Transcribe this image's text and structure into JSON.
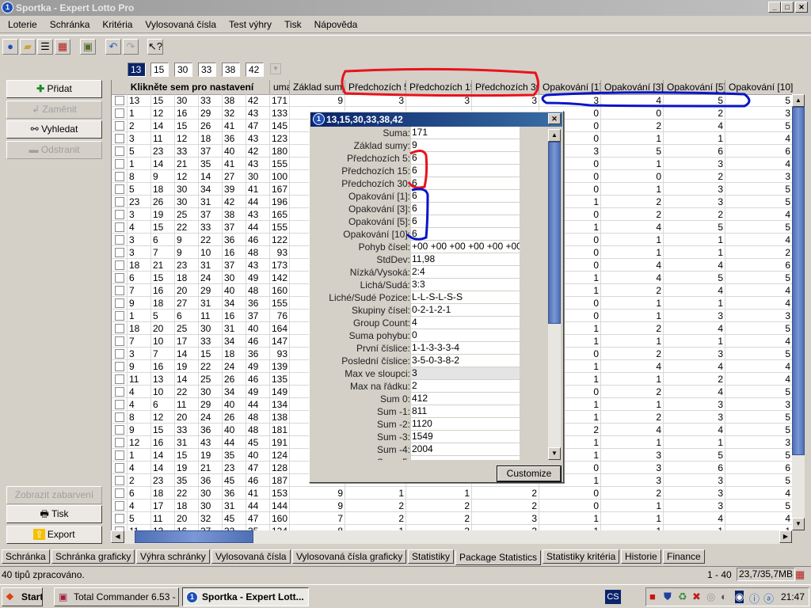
{
  "window": {
    "title": "Sportka - Expert Lotto Pro",
    "minimize": "_",
    "maximize": "□",
    "close": "✕"
  },
  "menu": [
    "Loterie",
    "Schránka",
    "Kritéria",
    "Vylosovaná čísla",
    "Test výhry",
    "Tisk",
    "Nápověda"
  ],
  "toolbar_icons": [
    "globe-icon",
    "open-folder-icon",
    "list-icon",
    "calendar-icon",
    "save-icon",
    "undo-icon",
    "redo-icon",
    "context-help-icon"
  ],
  "selected_numbers": [
    "13",
    "15",
    "30",
    "33",
    "38",
    "42"
  ],
  "left_buttons": {
    "add": "Přidat",
    "replace": "Zaměnit",
    "search": "Vyhledat",
    "remove": "Odstranit",
    "show_colors": "Zobrazit zabarvení",
    "print": "Tisk",
    "export": "Export"
  },
  "grid": {
    "header_settings": "Klikněte sem pro nastavení",
    "columns": [
      "uma",
      "Základ sumy",
      "Předchozích 5",
      "Předchozích 15",
      "Předchozích 30",
      "Opakování [1]",
      "Opakování [3]",
      "Opakování [5]",
      "Opakování [10]"
    ],
    "rows": [
      [
        "13",
        "15",
        "30",
        "33",
        "38",
        "42",
        "171",
        "9",
        "3",
        "3",
        "3",
        "3",
        "4",
        "5",
        "5"
      ],
      [
        "1",
        "12",
        "16",
        "29",
        "32",
        "43",
        "133",
        "",
        "",
        "",
        "",
        "0",
        "0",
        "2",
        "3"
      ],
      [
        "2",
        "14",
        "15",
        "26",
        "41",
        "47",
        "145",
        "",
        "",
        "",
        "",
        "0",
        "2",
        "4",
        "5"
      ],
      [
        "3",
        "11",
        "12",
        "18",
        "36",
        "43",
        "123",
        "",
        "",
        "",
        "",
        "0",
        "1",
        "1",
        "4"
      ],
      [
        "5",
        "23",
        "33",
        "37",
        "40",
        "42",
        "180",
        "",
        "",
        "",
        "",
        "3",
        "5",
        "6",
        "6"
      ],
      [
        "1",
        "14",
        "21",
        "35",
        "41",
        "43",
        "155",
        "",
        "",
        "",
        "",
        "0",
        "1",
        "3",
        "4"
      ],
      [
        "8",
        "9",
        "12",
        "14",
        "27",
        "30",
        "100",
        "",
        "",
        "",
        "",
        "0",
        "0",
        "2",
        "3"
      ],
      [
        "5",
        "18",
        "30",
        "34",
        "39",
        "41",
        "167",
        "",
        "",
        "",
        "",
        "0",
        "1",
        "3",
        "5"
      ],
      [
        "23",
        "26",
        "30",
        "31",
        "42",
        "44",
        "196",
        "",
        "",
        "",
        "",
        "1",
        "2",
        "3",
        "5"
      ],
      [
        "3",
        "19",
        "25",
        "37",
        "38",
        "43",
        "165",
        "",
        "",
        "",
        "",
        "0",
        "2",
        "2",
        "4"
      ],
      [
        "4",
        "15",
        "22",
        "33",
        "37",
        "44",
        "155",
        "",
        "",
        "",
        "",
        "1",
        "4",
        "5",
        "5"
      ],
      [
        "3",
        "6",
        "9",
        "22",
        "36",
        "46",
        "122",
        "",
        "",
        "",
        "",
        "0",
        "1",
        "1",
        "4"
      ],
      [
        "3",
        "7",
        "9",
        "10",
        "16",
        "48",
        "93",
        "",
        "",
        "",
        "",
        "0",
        "1",
        "1",
        "2"
      ],
      [
        "18",
        "21",
        "23",
        "31",
        "37",
        "43",
        "173",
        "",
        "",
        "",
        "",
        "0",
        "4",
        "4",
        "6"
      ],
      [
        "6",
        "15",
        "18",
        "24",
        "30",
        "49",
        "142",
        "",
        "",
        "",
        "",
        "1",
        "4",
        "5",
        "5"
      ],
      [
        "7",
        "16",
        "20",
        "29",
        "40",
        "48",
        "160",
        "",
        "",
        "",
        "",
        "1",
        "2",
        "4",
        "4"
      ],
      [
        "9",
        "18",
        "27",
        "31",
        "34",
        "36",
        "155",
        "",
        "",
        "",
        "",
        "0",
        "1",
        "1",
        "4"
      ],
      [
        "1",
        "5",
        "6",
        "11",
        "16",
        "37",
        "76",
        "",
        "",
        "",
        "",
        "0",
        "1",
        "3",
        "3"
      ],
      [
        "18",
        "20",
        "25",
        "30",
        "31",
        "40",
        "164",
        "",
        "",
        "",
        "",
        "1",
        "2",
        "4",
        "5"
      ],
      [
        "7",
        "10",
        "17",
        "33",
        "34",
        "46",
        "147",
        "",
        "",
        "",
        "",
        "1",
        "1",
        "1",
        "4"
      ],
      [
        "3",
        "7",
        "14",
        "15",
        "18",
        "36",
        "93",
        "",
        "",
        "",
        "",
        "0",
        "2",
        "3",
        "5"
      ],
      [
        "9",
        "16",
        "19",
        "22",
        "24",
        "49",
        "139",
        "",
        "",
        "",
        "",
        "1",
        "4",
        "4",
        "4"
      ],
      [
        "11",
        "13",
        "14",
        "25",
        "26",
        "46",
        "135",
        "",
        "",
        "",
        "",
        "1",
        "1",
        "2",
        "4"
      ],
      [
        "4",
        "10",
        "22",
        "30",
        "34",
        "49",
        "149",
        "",
        "",
        "",
        "",
        "0",
        "2",
        "4",
        "5"
      ],
      [
        "4",
        "6",
        "11",
        "29",
        "40",
        "44",
        "134",
        "",
        "",
        "",
        "",
        "1",
        "1",
        "3",
        "3"
      ],
      [
        "8",
        "12",
        "20",
        "24",
        "26",
        "48",
        "138",
        "",
        "",
        "",
        "",
        "1",
        "2",
        "3",
        "5"
      ],
      [
        "9",
        "15",
        "33",
        "36",
        "40",
        "48",
        "181",
        "",
        "",
        "",
        "",
        "2",
        "4",
        "4",
        "5"
      ],
      [
        "12",
        "16",
        "31",
        "43",
        "44",
        "45",
        "191",
        "",
        "",
        "",
        "",
        "1",
        "1",
        "1",
        "3"
      ],
      [
        "1",
        "14",
        "15",
        "19",
        "35",
        "40",
        "124",
        "",
        "",
        "",
        "",
        "1",
        "3",
        "5",
        "5"
      ],
      [
        "4",
        "14",
        "19",
        "21",
        "23",
        "47",
        "128",
        "",
        "",
        "",
        "",
        "0",
        "3",
        "6",
        "6"
      ],
      [
        "2",
        "23",
        "35",
        "36",
        "45",
        "46",
        "187",
        "",
        "",
        "",
        "",
        "1",
        "3",
        "3",
        "5"
      ],
      [
        "6",
        "18",
        "22",
        "30",
        "36",
        "41",
        "153",
        "9",
        "1",
        "1",
        "2",
        "0",
        "2",
        "3",
        "4"
      ],
      [
        "4",
        "17",
        "18",
        "30",
        "31",
        "44",
        "144",
        "9",
        "2",
        "2",
        "2",
        "0",
        "1",
        "3",
        "5"
      ],
      [
        "5",
        "11",
        "20",
        "32",
        "45",
        "47",
        "160",
        "7",
        "2",
        "2",
        "3",
        "1",
        "1",
        "4",
        "4"
      ],
      [
        "11",
        "13",
        "16",
        "27",
        "32",
        "35",
        "134",
        "8",
        "1",
        "3",
        "3",
        "1",
        "1",
        "1",
        "1"
      ]
    ]
  },
  "dialog": {
    "title": "13,15,30,33,38,42",
    "close": "✕",
    "selected_row": "Max ve sloupci:",
    "stats": [
      {
        "label": "Suma:",
        "value": "171"
      },
      {
        "label": "Základ sumy:",
        "value": "9"
      },
      {
        "label": "Předchozích 5:",
        "value": "6"
      },
      {
        "label": "Předchozích 15:",
        "value": "6"
      },
      {
        "label": "Předchozích 30:",
        "value": "6"
      },
      {
        "label": "Opakování [1]:",
        "value": "6"
      },
      {
        "label": "Opakování [3]:",
        "value": "6"
      },
      {
        "label": "Opakování [5]:",
        "value": "6"
      },
      {
        "label": "Opakování [10]:",
        "value": "6"
      },
      {
        "label": "Pohyb čísel:",
        "value": "+00 +00 +00 +00 +00 +00"
      },
      {
        "label": "StdDev:",
        "value": "11,98"
      },
      {
        "label": "Nízká/Vysoká:",
        "value": "2:4"
      },
      {
        "label": "Lichá/Sudá:",
        "value": "3:3"
      },
      {
        "label": "Liché/Sudé Pozice:",
        "value": "L-L-S-L-S-S"
      },
      {
        "label": "Skupiny čísel:",
        "value": "0-2-1-2-1"
      },
      {
        "label": "Group Count:",
        "value": "4"
      },
      {
        "label": "Suma pohybu:",
        "value": "0"
      },
      {
        "label": "První číslice:",
        "value": "1-1-3-3-3-4"
      },
      {
        "label": "Poslední číslice:",
        "value": "3-5-0-3-8-2"
      },
      {
        "label": "Max ve sloupci:",
        "value": "3"
      },
      {
        "label": "Max na řádku:",
        "value": "2"
      },
      {
        "label": "Sum 0:",
        "value": "412"
      },
      {
        "label": "Sum -1:",
        "value": "811"
      },
      {
        "label": "Sum -2:",
        "value": "1120"
      },
      {
        "label": "Sum -3:",
        "value": "1549"
      },
      {
        "label": "Sum -4:",
        "value": "2004"
      },
      {
        "label": "Sum -5:",
        "value": ""
      }
    ],
    "customize": "Customize"
  },
  "tabs": [
    "Schránka",
    "Schránka graficky",
    "Výhra schránky",
    "Vylosovaná čísla",
    "Vylosovaná čísla graficky",
    "Statistiky",
    "Package Statistics",
    "Statistiky kritéria",
    "Historie",
    "Finance"
  ],
  "active_tab": "Package Statistics",
  "status": {
    "message": "40 tipů zpracováno.",
    "range": "1 - 40",
    "memory": "23,7/35,7MB"
  },
  "taskbar": {
    "start": "Start",
    "tasks": [
      "Total Commander 6.53 - ...",
      "Sportka - Expert Lott..."
    ],
    "language": "CS",
    "clock": "21:47"
  },
  "annotation_colors": {
    "red": "#e8131b",
    "blue": "#0a14c8"
  }
}
